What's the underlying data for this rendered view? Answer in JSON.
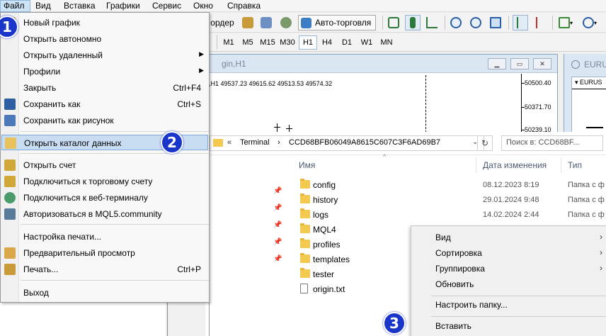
{
  "menubar": {
    "items": [
      "Файл",
      "Вид",
      "Вставка",
      "Графики",
      "Сервис",
      "Окно",
      "Справка"
    ]
  },
  "toolbar": {
    "order_label": "ордер",
    "algo_label": "Авто-торговля",
    "timeframes": [
      "M1",
      "M5",
      "M15",
      "M30",
      "H1",
      "H4",
      "D1",
      "W1",
      "MN"
    ],
    "active_timeframe": "H1"
  },
  "chart": {
    "title": "gin,H1",
    "info": ",H1  49537.23 49615.62 49513.53 49574.32",
    "prices": [
      "50500.40",
      "50371.70",
      "50239.10"
    ]
  },
  "right_window": {
    "title": "EURU",
    "symbol": "EURUS"
  },
  "file_menu": {
    "items": [
      {
        "label": "Новый график",
        "shortcut": "",
        "submenu": false
      },
      {
        "label": "Открыть автономно",
        "shortcut": "",
        "submenu": false
      },
      {
        "label": "Открыть удаленный",
        "shortcut": "",
        "submenu": true
      },
      {
        "label": "Профили",
        "shortcut": "",
        "submenu": true
      },
      {
        "label": "Закрыть",
        "shortcut": "Ctrl+F4",
        "submenu": false
      },
      {
        "label": "Сохранить как",
        "shortcut": "Ctrl+S",
        "submenu": false
      },
      {
        "label": "Сохранить как рисунок",
        "shortcut": "",
        "submenu": false
      },
      {
        "label": "Открыть каталог данных",
        "shortcut": "",
        "submenu": false
      },
      {
        "label": "Открыть счет",
        "shortcut": "",
        "submenu": false
      },
      {
        "label": "Подключиться к торговому счету",
        "shortcut": "",
        "submenu": false
      },
      {
        "label": "Подключиться к веб-терминалу",
        "shortcut": "",
        "submenu": false
      },
      {
        "label": "Авторизоваться в MQL5.community",
        "shortcut": "",
        "submenu": false
      },
      {
        "label": "Настройка печати...",
        "shortcut": "",
        "submenu": false
      },
      {
        "label": "Предварительный просмотр",
        "shortcut": "",
        "submenu": false
      },
      {
        "label": "Печать...",
        "shortcut": "Ctrl+P",
        "submenu": false
      },
      {
        "label": "Выход",
        "shortcut": "",
        "submenu": false
      }
    ],
    "highlighted_index": 7
  },
  "explorer": {
    "path_root": "Terminal",
    "path_folder": "CCD68BFB06049A8615C607C3F6AD69B7",
    "search_placeholder": "Поиск в: CCD68BF...",
    "columns": [
      "Имя",
      "Дата изменения",
      "Тип"
    ],
    "files": [
      {
        "name": "config",
        "date": "08.12.2023 8:19",
        "type": "Папка с ф",
        "kind": "folder"
      },
      {
        "name": "history",
        "date": "29.01.2024 9:48",
        "type": "Папка с ф",
        "kind": "folder"
      },
      {
        "name": "logs",
        "date": "14.02.2024 2:44",
        "type": "Папка с ф",
        "kind": "folder"
      },
      {
        "name": "MQL4",
        "date": "",
        "type": "",
        "kind": "folder"
      },
      {
        "name": "profiles",
        "date": "",
        "type": "",
        "kind": "folder"
      },
      {
        "name": "templates",
        "date": "",
        "type": "",
        "kind": "folder"
      },
      {
        "name": "tester",
        "date": "",
        "type": "",
        "kind": "folder"
      },
      {
        "name": "origin.txt",
        "date": "",
        "type": "",
        "kind": "file"
      }
    ]
  },
  "context_menu": {
    "items": [
      "Вид",
      "Сортировка",
      "Группировка",
      "Обновить",
      "Настроить папку...",
      "Вставить"
    ]
  },
  "badges": [
    "1",
    "2",
    "3"
  ]
}
